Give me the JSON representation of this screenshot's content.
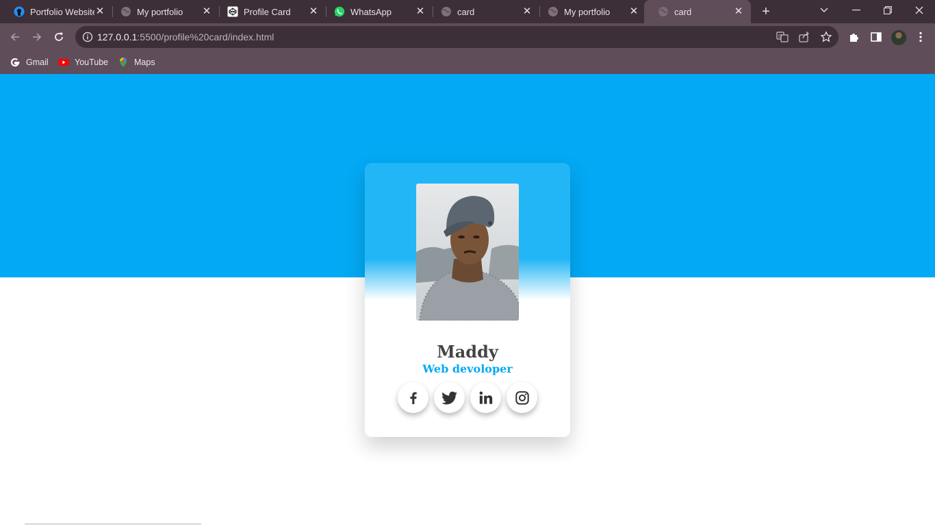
{
  "browser": {
    "tabs": [
      {
        "label": "Portfolio Website",
        "icon": "github-icon"
      },
      {
        "label": "My portfolio",
        "icon": "globe-icon"
      },
      {
        "label": "Profile Card",
        "icon": "codepen-icon"
      },
      {
        "label": "WhatsApp",
        "icon": "whatsapp-icon"
      },
      {
        "label": "card",
        "icon": "globe-icon"
      },
      {
        "label": "My portfolio",
        "icon": "globe-icon"
      },
      {
        "label": "card",
        "icon": "globe-icon",
        "active": true
      }
    ],
    "url": {
      "host": "127.0.0.1",
      "rest": ":5500/profile%20card/index.html"
    },
    "bookmarks": [
      {
        "label": "Gmail",
        "icon": "google-icon"
      },
      {
        "label": "YouTube",
        "icon": "youtube-icon"
      },
      {
        "label": "Maps",
        "icon": "maps-icon"
      }
    ]
  },
  "page": {
    "colors": {
      "accent": "#03a9f4",
      "name_text": "#444444"
    },
    "card": {
      "name": "Maddy",
      "role": "Web devoloper",
      "photo": "profile-photo",
      "socials": [
        {
          "network": "facebook",
          "icon": "facebook-icon"
        },
        {
          "network": "twitter",
          "icon": "twitter-icon"
        },
        {
          "network": "linkedin",
          "icon": "linkedin-icon"
        },
        {
          "network": "instagram",
          "icon": "instagram-icon"
        }
      ]
    }
  }
}
